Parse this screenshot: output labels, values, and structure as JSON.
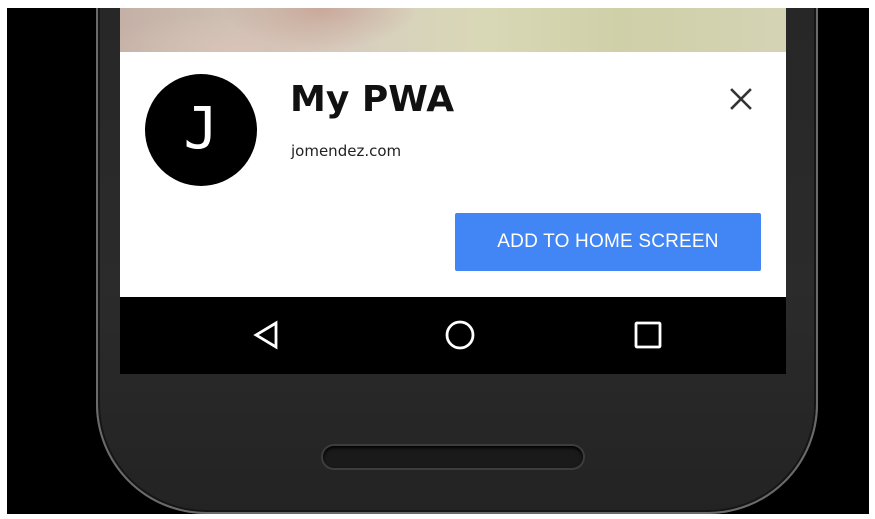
{
  "banner": {
    "icon_letter": "J",
    "app_name": "My PWA",
    "app_url": "jomendez.com",
    "close_icon": "close-icon",
    "add_button_label": "ADD TO HOME SCREEN"
  },
  "navbar": {
    "back_icon": "triangle-back-icon",
    "home_icon": "circle-home-icon",
    "recents_icon": "square-recents-icon"
  },
  "colors": {
    "button_blue": "#4285f4",
    "banner_bg": "#ffffff",
    "navbar_bg": "#000000",
    "phone_body": "#262626"
  }
}
